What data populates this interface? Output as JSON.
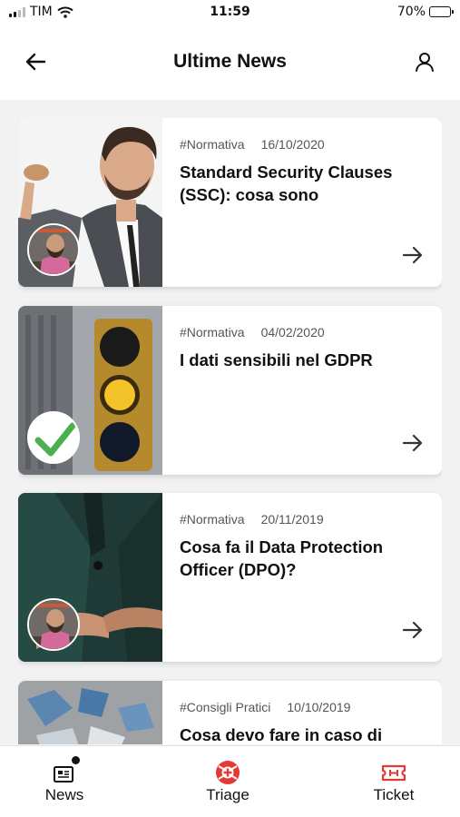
{
  "status_bar": {
    "carrier": "TIM",
    "time": "11:59",
    "battery": "70%",
    "battery_level": 0.7
  },
  "header": {
    "title": "Ultime News",
    "back_icon": "arrow-left-icon",
    "profile_icon": "user-icon"
  },
  "news": [
    {
      "category": "#Normativa",
      "date": "16/10/2020",
      "title": "Standard Security Clauses (SSC): cosa sono",
      "image": "businessman-photo",
      "badge": "author-avatar"
    },
    {
      "category": "#Normativa",
      "date": "04/02/2020",
      "title": "I dati sensibili nel GDPR",
      "image": "traffic-light-photo",
      "badge": "checkmark"
    },
    {
      "category": "#Normativa",
      "date": "20/11/2019",
      "title": "Cosa fa il Data Protection Officer (DPO)?",
      "image": "suit-buttons-photo",
      "badge": "author-avatar"
    },
    {
      "category": "#Consigli Pratici",
      "date": "10/10/2019",
      "title": "Cosa devo fare in caso di",
      "image": "broken-glass-photo",
      "badge": ""
    }
  ],
  "tabs": [
    {
      "label": "News",
      "icon": "newspaper-icon"
    },
    {
      "label": "Triage",
      "icon": "lifebuoy-icon"
    },
    {
      "label": "Ticket",
      "icon": "ticket-icon"
    }
  ],
  "colors": {
    "accent_red": "#e53935",
    "check_green": "#4caf50",
    "battery_green": "#4cd964"
  }
}
